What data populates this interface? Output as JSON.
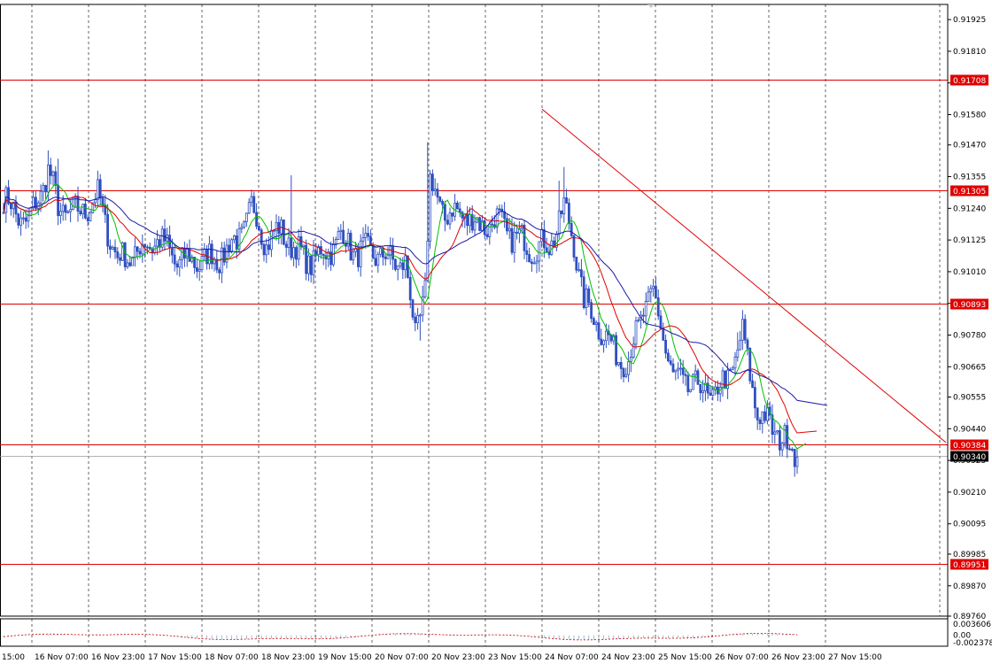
{
  "chart_data": [
    {
      "type": "candlestick",
      "symbol_axis": "price",
      "ylim": [
        0.8976,
        0.9198
      ],
      "y_ticks": [
        "0.91925",
        "0.91810",
        "0.91695",
        "0.91580",
        "0.91470",
        "0.91355",
        "0.91240",
        "0.91125",
        "0.91010",
        "0.90895",
        "0.90780",
        "0.90665",
        "0.90555",
        "0.90440",
        "0.90325",
        "0.90210",
        "0.90095",
        "0.89985",
        "0.89870",
        "0.89760"
      ],
      "x_ticks": [
        "15:00",
        "16 Nov 07:00",
        "16 Nov 23:00",
        "17 Nov 15:00",
        "18 Nov 07:00",
        "18 Nov 23:00",
        "19 Nov 15:00",
        "20 Nov 07:00",
        "20 Nov 23:00",
        "23 Nov 15:00",
        "24 Nov 07:00",
        "24 Nov 23:00",
        "25 Nov 15:00",
        "26 Nov 07:00",
        "26 Nov 23:00",
        "27 Nov 15:00"
      ],
      "grid": true,
      "horizontal_levels": [
        {
          "value": 0.91708,
          "label": "0.91708"
        },
        {
          "value": 0.91305,
          "label": "0.91305"
        },
        {
          "value": 0.90893,
          "label": "0.90893"
        },
        {
          "value": 0.90384,
          "label": "0.90384"
        },
        {
          "value": 0.89951,
          "label": "0.89951"
        }
      ],
      "current_price": {
        "value": 0.9034,
        "label": "0.90340"
      },
      "trendline": {
        "from": {
          "bar": 190,
          "price": 0.916
        },
        "to": {
          "bar": 340,
          "price": 0.9039
        }
      },
      "series_anchors": {
        "close": [
          [
            0,
            0.9127
          ],
          [
            10,
            0.9118
          ],
          [
            18,
            0.9138
          ],
          [
            22,
            0.9124
          ],
          [
            30,
            0.9122
          ],
          [
            38,
            0.9128
          ],
          [
            46,
            0.9105
          ],
          [
            54,
            0.9108
          ],
          [
            62,
            0.9113
          ],
          [
            70,
            0.9105
          ],
          [
            78,
            0.9105
          ],
          [
            86,
            0.9106
          ],
          [
            94,
            0.9112
          ],
          [
            100,
            0.9124
          ],
          [
            106,
            0.9112
          ],
          [
            112,
            0.9116
          ],
          [
            118,
            0.9108
          ],
          [
            124,
            0.9105
          ],
          [
            130,
            0.9108
          ],
          [
            136,
            0.9114
          ],
          [
            142,
            0.9108
          ],
          [
            150,
            0.9108
          ],
          [
            156,
            0.9105
          ],
          [
            162,
            0.9104
          ],
          [
            166,
            0.9078
          ],
          [
            170,
            0.9095
          ],
          [
            172,
            0.9133
          ],
          [
            178,
            0.9122
          ],
          [
            186,
            0.9122
          ],
          [
            192,
            0.9117
          ],
          [
            198,
            0.912
          ],
          [
            204,
            0.9115
          ],
          [
            212,
            0.911
          ],
          [
            220,
            0.911
          ],
          [
            226,
            0.9124
          ],
          [
            230,
            0.9112
          ],
          [
            234,
            0.909
          ],
          [
            240,
            0.9082
          ],
          [
            246,
            0.9072
          ],
          [
            252,
            0.9068
          ],
          [
            258,
            0.9088
          ],
          [
            262,
            0.9092
          ],
          [
            266,
            0.9078
          ],
          [
            270,
            0.9062
          ],
          [
            278,
            0.906
          ],
          [
            286,
            0.9056
          ],
          [
            292,
            0.9062
          ],
          [
            298,
            0.9078
          ],
          [
            304,
            0.905
          ],
          [
            310,
            0.9044
          ],
          [
            315,
            0.904
          ],
          [
            320,
            0.9034
          ]
        ]
      },
      "moving_averages": [
        {
          "color": "#00c000"
        },
        {
          "color": "#e00000"
        },
        {
          "color": "#1a1aa8"
        }
      ],
      "candle_color": "#3050c0"
    },
    {
      "type": "line",
      "ylim": [
        -0.00237,
        0.0036
      ],
      "y_ticks": [
        "0.003606",
        "0.00",
        "-0.002378"
      ],
      "series": [
        {
          "color": "#c00000"
        },
        {
          "color": "#9aa6c8"
        }
      ]
    }
  ]
}
